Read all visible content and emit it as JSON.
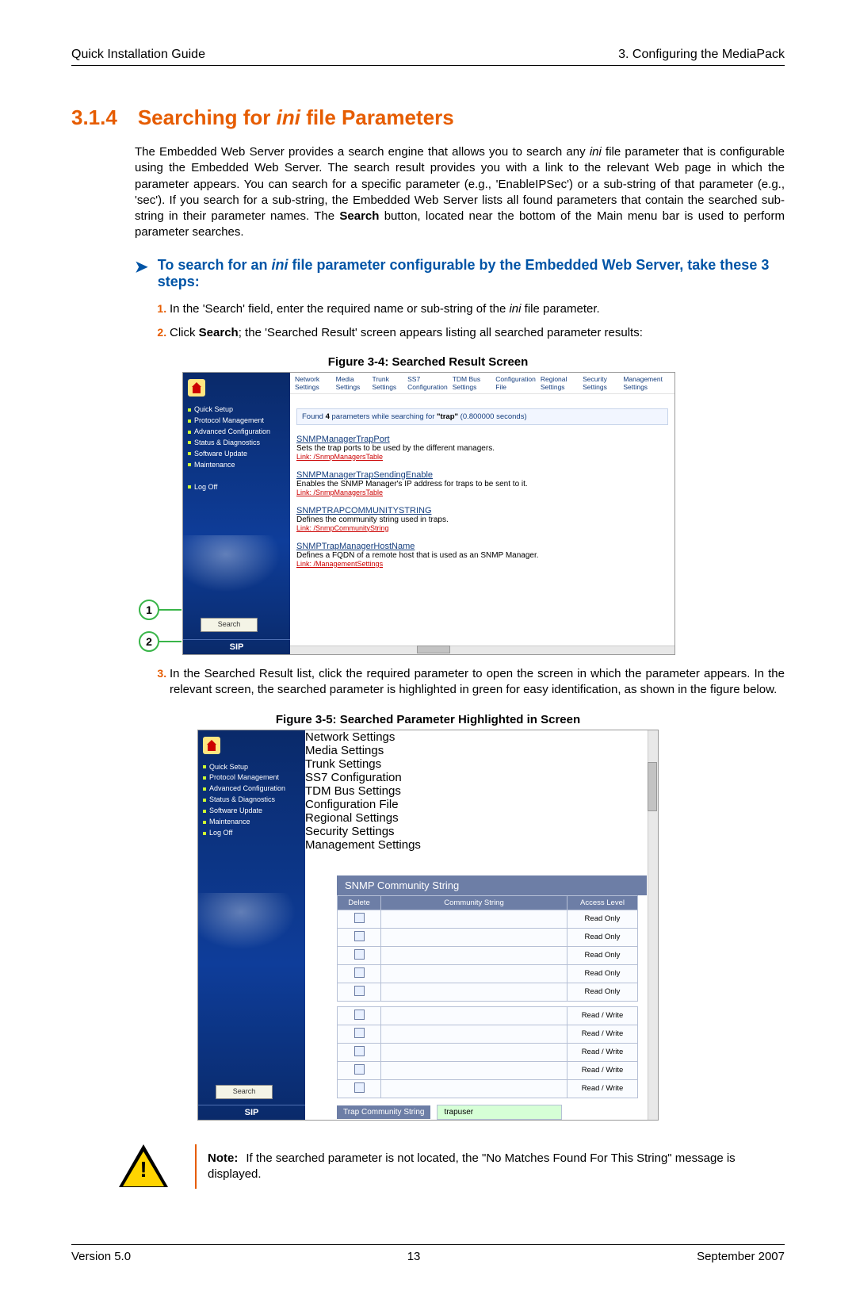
{
  "header": {
    "left": "Quick Installation Guide",
    "right": "3. Configuring the MediaPack"
  },
  "section": {
    "number": "3.1.4",
    "pre": "Searching for ",
    "ini": "ini",
    "post": " file Parameters"
  },
  "intro": {
    "a": "The Embedded Web Server provides a search engine that allows you to search any ",
    "ini": "ini",
    "b": " file parameter that is configurable using the Embedded Web Server. The search result provides you with a link to the relevant Web page in which the parameter appears. You can search for a specific parameter (e.g., 'EnableIPSec') or a sub-string of that parameter (e.g., 'sec'). If you search for a sub-string, the Embedded Web Server lists all found parameters that contain the searched sub-string in their parameter names. The ",
    "search": "Search",
    "c": " button, located near the bottom of the Main menu bar is used to perform parameter searches."
  },
  "subhead": {
    "a": "To search for an ",
    "ini": "ini",
    "b": " file parameter configurable by the Embedded Web Server, take these 3 steps:"
  },
  "step1": {
    "a": "In the 'Search' field, enter the required name or sub-string of the ",
    "ini": "ini",
    "b": " file parameter."
  },
  "step2": {
    "a": "Click ",
    "search": "Search",
    "b": "; the 'Searched Result' screen appears listing all searched parameter results:"
  },
  "fig34caption": "Figure 3-4: Searched Result Screen",
  "fig34": {
    "nav": [
      "Network Settings",
      "Media Settings",
      "Trunk Settings",
      "SS7 Configuration",
      "TDM Bus Settings",
      "Configuration File",
      "Regional Settings",
      "Security Settings",
      "Management Settings"
    ],
    "menu": [
      "Quick Setup",
      "Protocol Management",
      "Advanced Configuration",
      "Status & Diagnostics",
      "Software Update",
      "Maintenance",
      "",
      "Log Off"
    ],
    "search_btn": "Search",
    "sip": "SIP",
    "found_a": "Found ",
    "found_b": "4",
    "found_c": " parameters while searching for ",
    "found_q": "\"trap\"",
    "found_t": "  (0.800000 seconds)",
    "r1": {
      "t": "SNMPManagerTrapPort",
      "d": "Sets the trap ports to be used by the different managers.",
      "l": "Link:  /SnmpManagersTable"
    },
    "r2": {
      "t": "SNMPManagerTrapSendingEnable",
      "d": "Enables the SNMP Manager's IP address for traps to be sent to it.",
      "l": "Link:  /SnmpManagersTable"
    },
    "r3": {
      "t": "SNMPTRAPCOMMUNITYSTRING",
      "d": "Defines the community string used in traps.",
      "l": "Link:  /SnmpCommunityString"
    },
    "r4": {
      "t": "SNMPTrapManagerHostName",
      "d": "Defines a FQDN of a remote host that is used as an SNMP Manager.",
      "l": "Link:  /ManagementSettings"
    }
  },
  "step3": "In the Searched Result list, click the required parameter to open the screen in which the parameter appears. In the relevant screen, the searched parameter is highlighted in green for easy identification, as shown in the figure below.",
  "fig35caption": "Figure 3-5: Searched Parameter Highlighted in Screen",
  "fig35": {
    "panel_title": "SNMP Community String",
    "cols": [
      "Delete",
      "Community String",
      "Access Level"
    ],
    "rows": [
      {
        "access": "Read Only"
      },
      {
        "access": "Read Only"
      },
      {
        "access": "Read Only"
      },
      {
        "access": "Read Only"
      },
      {
        "access": "Read Only"
      },
      {
        "access": "Read / Write"
      },
      {
        "access": "Read / Write"
      },
      {
        "access": "Read / Write"
      },
      {
        "access": "Read / Write"
      },
      {
        "access": "Read / Write"
      }
    ],
    "trap_lbl": "Trap Community String",
    "trap_val": "trapuser"
  },
  "note": {
    "label": "Note:",
    "text": "If the searched parameter is not located, the \"No Matches Found For This String\" message is displayed."
  },
  "footer": {
    "left": "Version 5.0",
    "center": "13",
    "right": "September 2007"
  }
}
